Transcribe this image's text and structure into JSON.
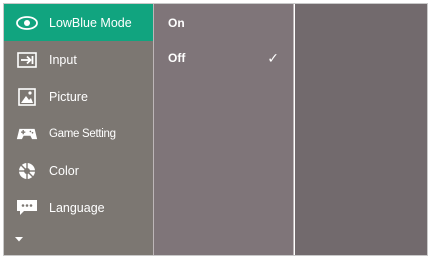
{
  "menu": {
    "items": [
      {
        "label": "LowBlue Mode",
        "icon": "eye-icon",
        "active": true
      },
      {
        "label": "Input",
        "icon": "input-icon"
      },
      {
        "label": "Picture",
        "icon": "picture-icon"
      },
      {
        "label": "Game Setting",
        "icon": "gamepad-icon"
      },
      {
        "label": "Color",
        "icon": "color-wheel-icon"
      },
      {
        "label": "Language",
        "icon": "language-icon"
      }
    ],
    "more_icon": "chevron-down-icon"
  },
  "submenu": {
    "options": [
      {
        "label": "On",
        "selected": false
      },
      {
        "label": "Off",
        "selected": true
      }
    ],
    "check_glyph": "✓"
  },
  "colors": {
    "active": "#11a47f",
    "main_column": "#7c7772",
    "sub_column": "#7f7579",
    "right_panel": "#726a6d"
  }
}
